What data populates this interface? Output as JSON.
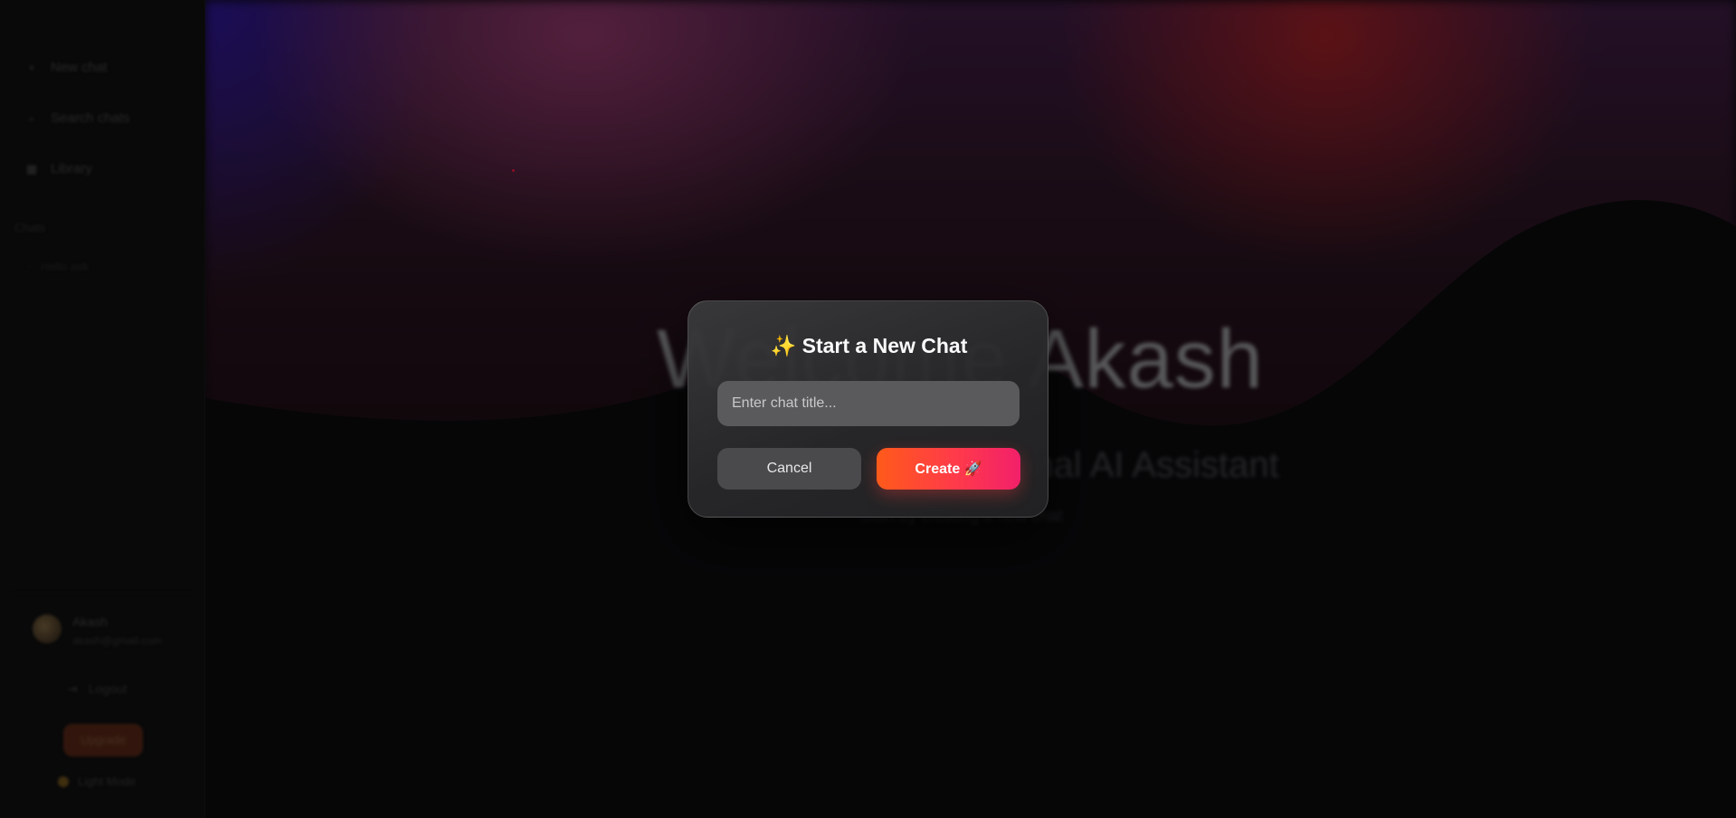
{
  "sidebar": {
    "nav": [
      {
        "label": "New chat",
        "icon": "plus-icon"
      },
      {
        "label": "Search chats",
        "icon": "search-icon"
      },
      {
        "label": "Library",
        "icon": "library-icon"
      }
    ],
    "section_label": "Chats",
    "chat_item": "Hello ask",
    "profile": {
      "name": "Akash",
      "email": "akash@gmail.com"
    },
    "logout_label": "Logout",
    "upgrade_label": "Upgrade",
    "theme_label": "Light Mode"
  },
  "hero": {
    "welcome": "Welcome Akash",
    "subtitle": "Your Personal AI Assistant",
    "tagline": "Start by creating a new chat"
  },
  "modal": {
    "title": "✨ Start a New Chat",
    "input_placeholder": "Enter chat title...",
    "cancel_label": "Cancel",
    "create_label": "Create 🚀"
  },
  "colors": {
    "accent_start": "#ff5a1a",
    "accent_end": "#f2206a",
    "modal_bg": "#2c2c2e"
  }
}
